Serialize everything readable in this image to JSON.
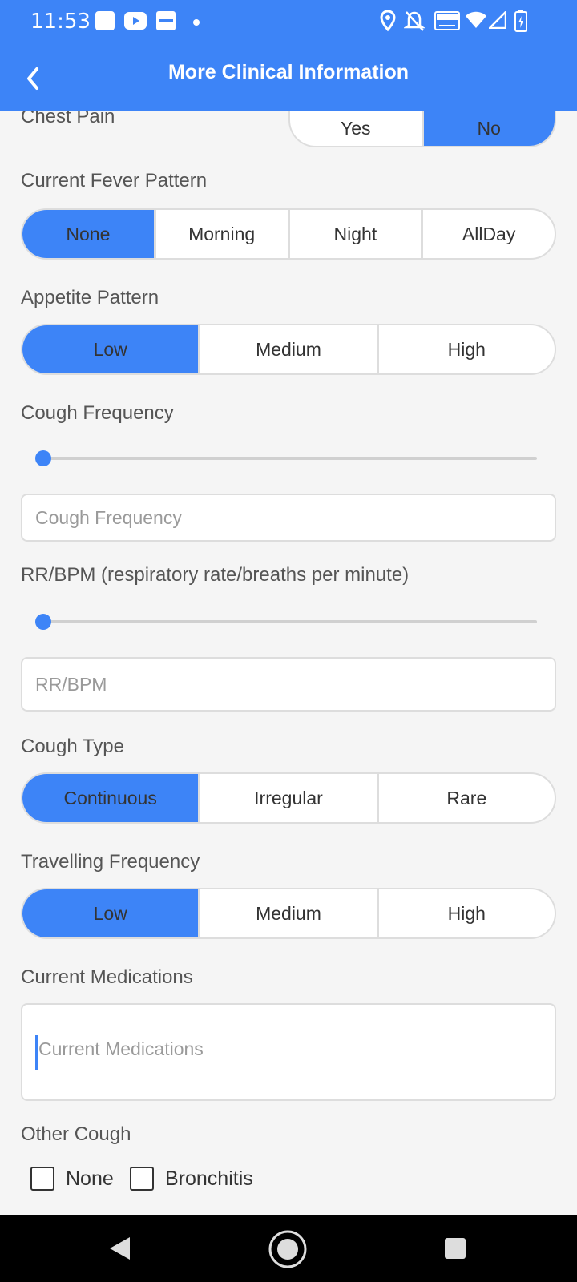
{
  "status_bar": {
    "time": "11:53"
  },
  "app_bar": {
    "title": "More Clinical Information"
  },
  "chest_pain": {
    "label": "Chest Pain",
    "options": [
      "Yes",
      "No"
    ],
    "selected": "No"
  },
  "fever_pattern": {
    "label": "Current Fever Pattern",
    "options": [
      "None",
      "Morning",
      "Night",
      "AllDay"
    ],
    "selected": "None"
  },
  "appetite_pattern": {
    "label": "Appetite Pattern",
    "options": [
      "Low",
      "Medium",
      "High"
    ],
    "selected": "Low"
  },
  "cough_frequency": {
    "label": "Cough Frequency",
    "slider_value": 0,
    "placeholder": "Cough Frequency"
  },
  "rr_bpm": {
    "label": "RR/BPM (respiratory rate/breaths per minute)",
    "slider_value": 0,
    "placeholder": "RR/BPM"
  },
  "cough_type": {
    "label": "Cough Type",
    "options": [
      "Continuous",
      "Irregular",
      "Rare"
    ],
    "selected": "Continuous"
  },
  "travelling_frequency": {
    "label": "Travelling Frequency",
    "options": [
      "Low",
      "Medium",
      "High"
    ],
    "selected": "Low"
  },
  "current_medications": {
    "label": "Current Medications",
    "placeholder": "Current Medications"
  },
  "other_cough": {
    "label": "Other Cough",
    "options": [
      {
        "label": "None",
        "checked": false
      },
      {
        "label": "Bronchitis",
        "checked": false
      }
    ]
  },
  "colors": {
    "primary": "#3d84f7",
    "background": "#f5f5f5",
    "nav_bar": "#000000"
  },
  "icons": [
    "youtube-icon",
    "paytm-icon",
    "location-icon",
    "mute-icon",
    "volte-icon",
    "wifi-icon",
    "signal-icon",
    "battery-icon",
    "back-arrow-icon",
    "nav-back-icon",
    "nav-home-icon",
    "nav-recents-icon"
  ]
}
